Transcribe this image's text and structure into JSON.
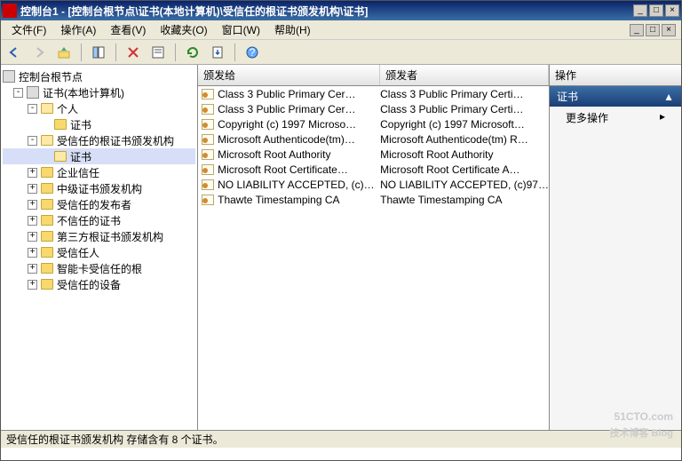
{
  "window": {
    "title": "控制台1 - [控制台根节点\\证书(本地计算机)\\受信任的根证书颁发机构\\证书]",
    "btn_min": "_",
    "btn_max": "□",
    "btn_close": "×"
  },
  "menu": {
    "file": "文件(F)",
    "action": "操作(A)",
    "view": "查看(V)",
    "favorites": "收藏夹(O)",
    "window": "窗口(W)",
    "help": "帮助(H)"
  },
  "tree": {
    "root": "控制台根节点",
    "cert_local": "证书(本地计算机)",
    "personal": "个人",
    "personal_certs": "证书",
    "trusted_root": "受信任的根证书颁发机构",
    "trusted_root_certs": "证书",
    "enterprise": "企业信任",
    "intermediate": "中级证书颁发机构",
    "trusted_pub": "受信任的发布者",
    "untrusted": "不信任的证书",
    "thirdparty": "第三方根证书颁发机构",
    "trusted_people": "受信任人",
    "smartcard": "智能卡受信任的根",
    "trusted_dev": "受信任的设备"
  },
  "list": {
    "col1": "颁发给",
    "col2": "颁发者",
    "rows": [
      {
        "to": "Class 3 Public Primary Cer…",
        "by": "Class 3 Public Primary Certi…"
      },
      {
        "to": "Class 3 Public Primary Cer…",
        "by": "Class 3 Public Primary Certi…"
      },
      {
        "to": "Copyright (c) 1997 Microso…",
        "by": "Copyright (c) 1997 Microsoft…"
      },
      {
        "to": "Microsoft Authenticode(tm)…",
        "by": "Microsoft Authenticode(tm) R…"
      },
      {
        "to": "Microsoft Root Authority",
        "by": "Microsoft Root Authority"
      },
      {
        "to": "Microsoft Root Certificate…",
        "by": "Microsoft Root Certificate A…"
      },
      {
        "to": "NO LIABILITY ACCEPTED, (c)…",
        "by": "NO LIABILITY ACCEPTED, (c)97…"
      },
      {
        "to": "Thawte Timestamping CA",
        "by": "Thawte Timestamping CA"
      }
    ]
  },
  "actions": {
    "header": "操作",
    "selected": "证书",
    "arrow_up": "▲",
    "more": "更多操作",
    "more_arrow": "▸"
  },
  "statusbar": "受信任的根证书颁发机构 存储含有 8 个证书。",
  "watermark": {
    "main": "51CTO.com",
    "sub": "技术博客 Blog"
  }
}
